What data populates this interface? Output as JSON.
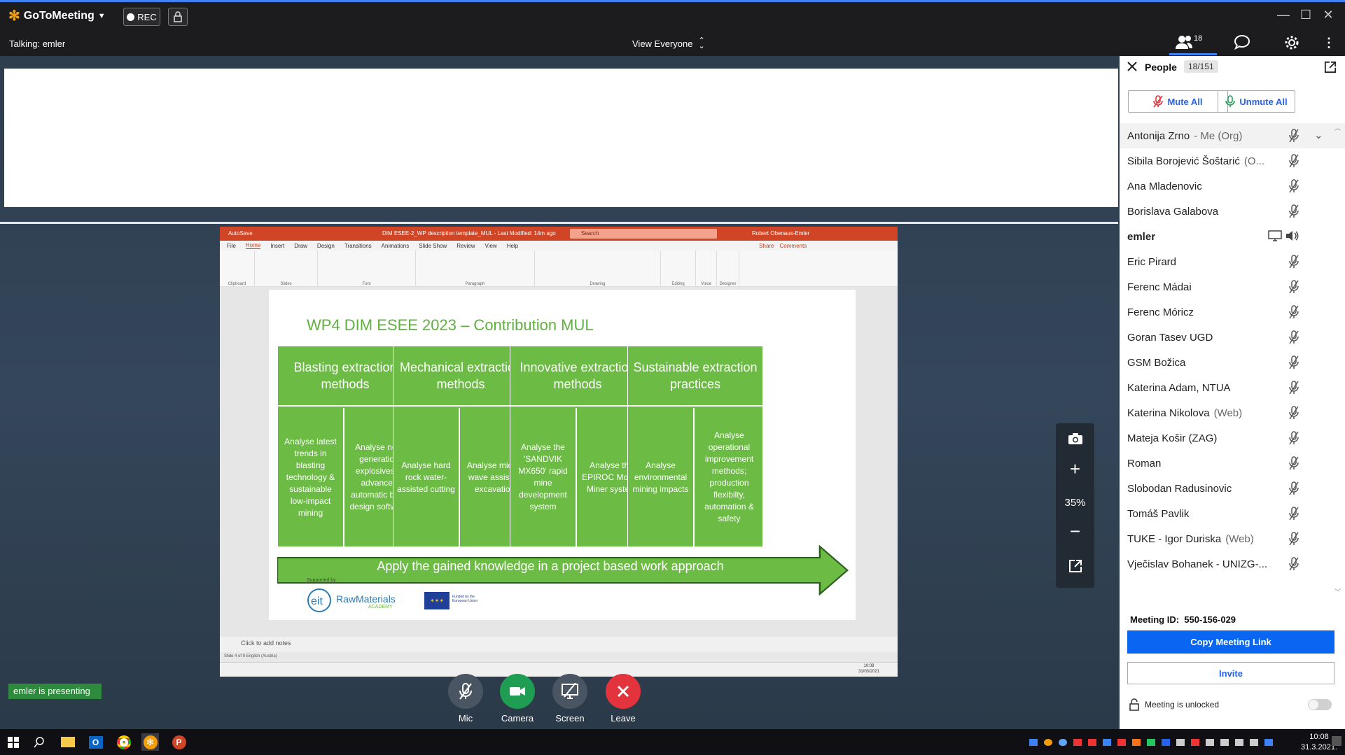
{
  "app": {
    "name": "GoToMeeting",
    "rec_label": "REC"
  },
  "status": {
    "talking": "Talking: emler",
    "view": "View Everyone",
    "people_badge": "18"
  },
  "zoom": {
    "level": "35%"
  },
  "presenting": "emler is presenting",
  "controls": [
    {
      "label": "Mic",
      "color": "#4a5563"
    },
    {
      "label": "Camera",
      "color": "#1f9e53"
    },
    {
      "label": "Screen",
      "color": "#4a5563"
    },
    {
      "label": "Leave",
      "color": "#e3333c"
    }
  ],
  "panel": {
    "title": "People",
    "count": "18/151",
    "mute_all": "Mute All",
    "unmute_all": "Unmute All",
    "participants": [
      {
        "name": "Antonija Zrno",
        "tag": "- Me (Org)"
      },
      {
        "name": "Sibila Borojević Šoštarić",
        "tag": "(O..."
      },
      {
        "name": "Ana Mladenovic",
        "tag": ""
      },
      {
        "name": "Borislava Galabova",
        "tag": ""
      },
      {
        "name": "emler",
        "tag": ""
      },
      {
        "name": "Eric Pirard",
        "tag": ""
      },
      {
        "name": "Ferenc Mádai",
        "tag": ""
      },
      {
        "name": "Ferenc Móricz",
        "tag": ""
      },
      {
        "name": "Goran Tasev UGD",
        "tag": ""
      },
      {
        "name": "GSM Božica",
        "tag": ""
      },
      {
        "name": "Katerina Adam, NTUA",
        "tag": ""
      },
      {
        "name": "Katerina Nikolova",
        "tag": "(Web)"
      },
      {
        "name": "Mateja Košir (ZAG)",
        "tag": ""
      },
      {
        "name": "Roman",
        "tag": ""
      },
      {
        "name": "Slobodan Radusinovic",
        "tag": ""
      },
      {
        "name": "Tomáš Pavlik",
        "tag": ""
      },
      {
        "name": "TUKE - Igor Duriska",
        "tag": "(Web)"
      },
      {
        "name": "Vječislav Bohanek - UNIZG-...",
        "tag": ""
      }
    ],
    "meeting_id_label": "Meeting ID:",
    "meeting_id": "550-156-029",
    "copy_link": "Copy Meeting Link",
    "invite": "Invite",
    "lock_status": "Meeting is unlocked"
  },
  "ppt": {
    "titlebar": "DIM ESEE-2_WP description template_MUL - Last Modified: 14m ago",
    "search": "Search",
    "user": "Robert Obenaus-Emler",
    "autosave": "AutoSave",
    "tabs": [
      "File",
      "Home",
      "Insert",
      "Draw",
      "Design",
      "Transitions",
      "Animations",
      "Slide Show",
      "Review",
      "View",
      "Help"
    ],
    "share": "Share",
    "comments": "Comments",
    "groups": [
      "Clipboard",
      "Slides",
      "Font",
      "Paragraph",
      "Drawing",
      "Editing",
      "Voice",
      "Designer"
    ],
    "notes": "Click to add notes",
    "statusbar": "Slide 4 of 9     English (Austria)",
    "clock_time": "10:08",
    "clock_date": "31/03/2021",
    "slide": {
      "title": "WP4 DIM ESEE 2023 – Contribution MUL",
      "columns": [
        {
          "head": "Blasting extraction methods",
          "left": "Analyse latest trends in blasting technology & sustainable low-impact mining",
          "right": "Analyse next generation explosives & advanced automatic blast design software"
        },
        {
          "head": "Mechanical extraction methods",
          "left": "Analyse hard rock water-assisted cutting",
          "right": "Analyse micro-wave assisted excavation"
        },
        {
          "head": "Innovative extraction methods",
          "left": "Analyse the 'SANDVIK MX650' rapid mine development system",
          "right": "Analyse the EPIROC Mobile Miner system"
        },
        {
          "head": "Sustainable extraction practices",
          "left": "Analyse environmental mining impacts",
          "right": "Analyse operational improvement methods; production flexibilty, automation & safety"
        }
      ],
      "arrow": "Apply the gained knowledge in a project based work approach",
      "supported": "Supported by",
      "raw1": "RawMaterials",
      "raw2": "ACADEMY",
      "eu": "Funded by the European Union"
    }
  },
  "taskbar": {
    "time": "10:08",
    "date": "31.3.2021."
  }
}
